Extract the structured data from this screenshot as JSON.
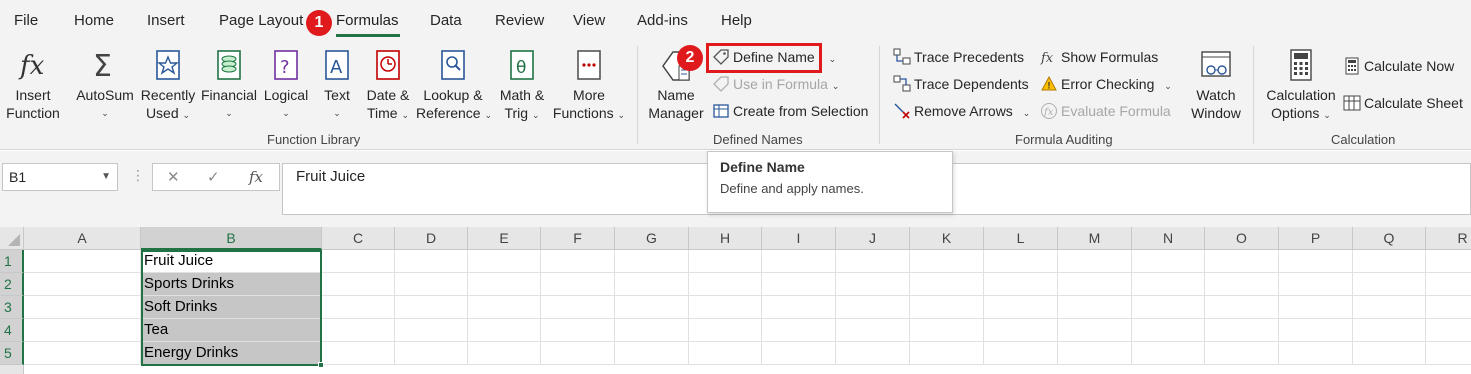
{
  "tabs": [
    "File",
    "Home",
    "Insert",
    "Page Layout",
    "Formulas",
    "Data",
    "Review",
    "View",
    "Add-ins",
    "Help"
  ],
  "active_tab": "Formulas",
  "annotations": {
    "badge1": "1",
    "badge2": "2"
  },
  "function_library": {
    "insert_function": [
      "Insert",
      "Function"
    ],
    "autosum": "AutoSum",
    "recently_used": [
      "Recently",
      "Used"
    ],
    "financial": "Financial",
    "logical": "Logical",
    "text": "Text",
    "date_time": [
      "Date &",
      "Time"
    ],
    "lookup_reference": [
      "Lookup &",
      "Reference"
    ],
    "math_trig": [
      "Math &",
      "Trig"
    ],
    "more_functions": [
      "More",
      "Functions"
    ],
    "group_label": "Function Library"
  },
  "defined_names": {
    "name_manager": [
      "Name",
      "Manager"
    ],
    "define_name": "Define Name",
    "use_in_formula": "Use in Formula",
    "create_from_selection": "Create from Selection",
    "group_label": "Defined Names"
  },
  "formula_auditing": {
    "trace_precedents": "Trace Precedents",
    "trace_dependents": "Trace Dependents",
    "remove_arrows": "Remove Arrows",
    "show_formulas": "Show Formulas",
    "error_checking": "Error Checking",
    "evaluate_formula": "Evaluate Formula",
    "watch_window": [
      "Watch",
      "Window"
    ],
    "group_label": "Formula Auditing"
  },
  "calculation": {
    "calculation_options": [
      "Calculation",
      "Options"
    ],
    "calculate_now": "Calculate Now",
    "calculate_sheet": "Calculate Sheet",
    "group_label": "Calculation"
  },
  "formula_bar": {
    "name_box": "B1",
    "formula": "Fruit Juice"
  },
  "tooltip": {
    "title": "Define Name",
    "description": "Define and apply names."
  },
  "sheet": {
    "columns": [
      "A",
      "B",
      "C",
      "D",
      "E",
      "F",
      "G",
      "H",
      "I",
      "J",
      "K",
      "L",
      "M",
      "N",
      "O",
      "P",
      "Q",
      "R"
    ],
    "rows": [
      "1",
      "2",
      "3",
      "4",
      "5"
    ],
    "column_b_values": [
      "Fruit Juice",
      "Sports Drinks",
      "Soft Drinks",
      "Tea",
      "Energy Drinks"
    ]
  },
  "colors": {
    "accent": "#217346",
    "annotation": "#e0191d"
  }
}
